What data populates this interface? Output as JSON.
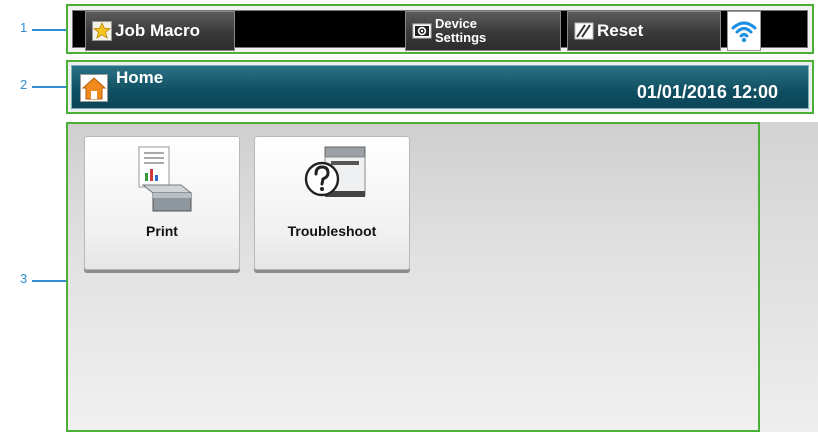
{
  "callouts": [
    "1",
    "2",
    "3"
  ],
  "toolbar": {
    "job_macro_label": "Job Macro",
    "job_macro_icon": "star-icon",
    "device_settings_line1": "Device",
    "device_settings_line2": "Settings",
    "device_settings_icon": "settings-screen-icon",
    "reset_label": "Reset",
    "reset_icon": "reset-icon",
    "wifi_icon": "wifi-icon"
  },
  "status": {
    "home_label": "Home",
    "home_icon": "home-icon",
    "datetime": "01/01/2016 12:00"
  },
  "tiles": [
    {
      "label": "Print",
      "icon": "print-icon"
    },
    {
      "label": "Troubleshoot",
      "icon": "troubleshoot-icon"
    }
  ],
  "colors": {
    "callout": "#2f8fd0",
    "frame": "#4ab03a",
    "status_bar": "#0f4f61"
  }
}
